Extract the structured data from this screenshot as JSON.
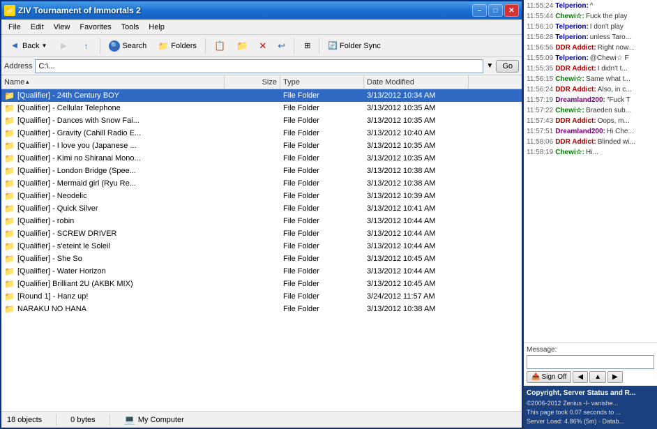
{
  "window": {
    "title": "ZIV Tournament of Immortals 2",
    "minimize_label": "–",
    "maximize_label": "□",
    "close_label": "✕"
  },
  "menu": {
    "items": [
      "File",
      "Edit",
      "View",
      "Favorites",
      "Tools",
      "Help"
    ]
  },
  "toolbar": {
    "back_label": "Back",
    "search_label": "Search",
    "folders_label": "Folders",
    "folder_sync_label": "Folder Sync",
    "address_label": "Address",
    "go_label": "Go"
  },
  "columns": {
    "name": "Name",
    "size": "Size",
    "type": "Type",
    "date": "Date Modified"
  },
  "files": [
    {
      "name": "[Qualifier] - 24th Century BOY",
      "size": "",
      "type": "File Folder",
      "date": "3/13/2012 10:34 AM",
      "selected": true
    },
    {
      "name": "[Qualifier] - Cellular Telephone",
      "size": "",
      "type": "File Folder",
      "date": "3/13/2012 10:35 AM",
      "selected": false
    },
    {
      "name": "[Qualifier] - Dances with Snow Fai...",
      "size": "",
      "type": "File Folder",
      "date": "3/13/2012 10:35 AM",
      "selected": false
    },
    {
      "name": "[Qualifier] - Gravity (Cahill Radio E...",
      "size": "",
      "type": "File Folder",
      "date": "3/13/2012 10:40 AM",
      "selected": false
    },
    {
      "name": "[Qualifier] - I love you (Japanese ...",
      "size": "",
      "type": "File Folder",
      "date": "3/13/2012 10:35 AM",
      "selected": false
    },
    {
      "name": "[Qualifier] - Kimi no Shiranai Mono...",
      "size": "",
      "type": "File Folder",
      "date": "3/13/2012 10:35 AM",
      "selected": false
    },
    {
      "name": "[Qualifier] - London Bridge (Spee...",
      "size": "",
      "type": "File Folder",
      "date": "3/13/2012 10:38 AM",
      "selected": false
    },
    {
      "name": "[Qualifier] - Mermaid girl (Ryu Re...",
      "size": "",
      "type": "File Folder",
      "date": "3/13/2012 10:38 AM",
      "selected": false
    },
    {
      "name": "[Qualifier] - Neodelic",
      "size": "",
      "type": "File Folder",
      "date": "3/13/2012 10:39 AM",
      "selected": false
    },
    {
      "name": "[Qualifier] - Quick Silver",
      "size": "",
      "type": "File Folder",
      "date": "3/13/2012 10:41 AM",
      "selected": false
    },
    {
      "name": "[Qualifier] - robin",
      "size": "",
      "type": "File Folder",
      "date": "3/13/2012 10:44 AM",
      "selected": false
    },
    {
      "name": "[Qualifier] - SCREW DRIVER",
      "size": "",
      "type": "File Folder",
      "date": "3/13/2012 10:44 AM",
      "selected": false
    },
    {
      "name": "[Qualifier] - s'eteint le Soleil",
      "size": "",
      "type": "File Folder",
      "date": "3/13/2012 10:44 AM",
      "selected": false
    },
    {
      "name": "[Qualifier] - She So",
      "size": "",
      "type": "File Folder",
      "date": "3/13/2012 10:45 AM",
      "selected": false
    },
    {
      "name": "[Qualifier] - Water Horizon",
      "size": "",
      "type": "File Folder",
      "date": "3/13/2012 10:44 AM",
      "selected": false
    },
    {
      "name": "[Qualifier] Brilliant 2U (AKBK MIX)",
      "size": "",
      "type": "File Folder",
      "date": "3/13/2012 10:45 AM",
      "selected": false
    },
    {
      "name": "[Round 1] - Hanz up!",
      "size": "",
      "type": "File Folder",
      "date": "3/24/2012 11:57 AM",
      "selected": false
    },
    {
      "name": "NARAKU NO HANA",
      "size": "",
      "type": "File Folder",
      "date": "3/13/2012 10:38 AM",
      "selected": false
    }
  ],
  "status": {
    "object_count": "18 objects",
    "size_label": "0 bytes",
    "computer_icon": "💻",
    "computer_label": "My Computer"
  },
  "chat": {
    "messages": [
      {
        "time": "11:55:24",
        "name": "Telperion:",
        "name_class": "telperion",
        "msg": "^"
      },
      {
        "time": "11:55:44",
        "name": "Chewi☆:",
        "name_class": "chewi",
        "msg": "Fuck the play"
      },
      {
        "time": "11:56:10",
        "name": "Telperion:",
        "name_class": "telperion",
        "msg": "I don't play"
      },
      {
        "time": "11:56:28",
        "name": "Telperion:",
        "name_class": "telperion",
        "msg": "unless Taro..."
      },
      {
        "time": "11:56:56",
        "name": "DDR Addict:",
        "name_class": "ddr",
        "msg": "Right now..."
      },
      {
        "time": "11:55:09",
        "name": "Telperion:",
        "name_class": "telperion",
        "msg": "@Chewi☆ F"
      },
      {
        "time": "11:55:35",
        "name": "DDR Addict:",
        "name_class": "ddr",
        "msg": "I didn't t..."
      },
      {
        "time": "11:56:15",
        "name": "Chewi☆:",
        "name_class": "chewi",
        "msg": "Same what t..."
      },
      {
        "time": "11:56:24",
        "name": "DDR Addict:",
        "name_class": "ddr",
        "msg": "Also, in c..."
      },
      {
        "time": "11:57:19",
        "name": "Dreamland200:",
        "name_class": "dreamland",
        "msg": "\"Fuck T"
      },
      {
        "time": "11:57:22",
        "name": "Chewi☆:",
        "name_class": "chewi",
        "msg": "Braeden sub..."
      },
      {
        "time": "11:57:43",
        "name": "DDR Addict:",
        "name_class": "ddr",
        "msg": "Oops, m..."
      },
      {
        "time": "11:57:51",
        "name": "Dreamland200:",
        "name_class": "dreamland",
        "msg": "Hi Che..."
      },
      {
        "time": "11:58:06",
        "name": "DDR Addict:",
        "name_class": "ddr",
        "msg": "Blinded wi..."
      },
      {
        "time": "11:58:19",
        "name": "Chewi☆:",
        "name_class": "chewi",
        "msg": "Hi..."
      }
    ],
    "message_label": "Message:",
    "sign_off_label": "Sign Off",
    "copyright_title": "Copyright, Server Status and R...",
    "copyright_body": "©2006-2012 Zenius -I- vanishe...\nThis page took 0.07 seconds to ...\nServer Load: 4.86% (5m) · Datab..."
  }
}
